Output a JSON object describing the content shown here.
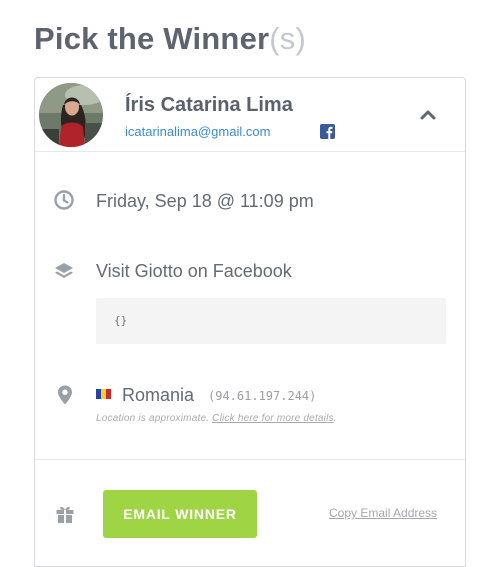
{
  "header": {
    "title_main": "Pick the Winner",
    "title_suffix": "(s)"
  },
  "winner": {
    "name": "Íris Catarina Lima",
    "email": "icatarinalima@gmail.com",
    "source_icon": "facebook-icon"
  },
  "entry": {
    "datetime": "Friday, Sep 18 @ 11:09 pm",
    "action": "Visit Giotto on Facebook",
    "action_data": "{}",
    "country": "Romania",
    "ip": "(94.61.197.244)",
    "location_note_prefix": "Location is approximate. ",
    "location_note_link": "Click here for more details",
    "location_note_suffix": "."
  },
  "actions": {
    "email_button": "EMAIL WINNER",
    "copy_link": "Copy Email Address"
  },
  "colors": {
    "accent": "#9fd445",
    "link": "#3d8dc9",
    "facebook": "#3b5a9a"
  }
}
